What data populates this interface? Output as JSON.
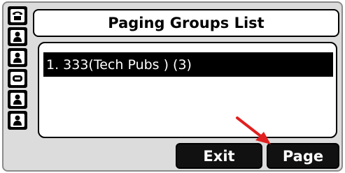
{
  "screen": {
    "title": "Paging Groups List"
  },
  "list": {
    "items": [
      {
        "label": "1. 333(Tech Pubs ) (3)"
      }
    ]
  },
  "softkeys": {
    "exit_label": "Exit",
    "page_label": "Page"
  },
  "sidebar": {
    "keys": [
      {
        "icon": "phone-handset-icon"
      },
      {
        "icon": "contact-icon"
      },
      {
        "icon": "contact-icon"
      },
      {
        "icon": "minus-line-icon"
      },
      {
        "icon": "contact-icon"
      },
      {
        "icon": "contact-icon"
      }
    ]
  },
  "annotation": {
    "arrow_color": "#e02020"
  },
  "colors": {
    "screen_bg": "#dcdcdc",
    "selection_bg": "#000000",
    "selection_text": "#ffffff"
  }
}
